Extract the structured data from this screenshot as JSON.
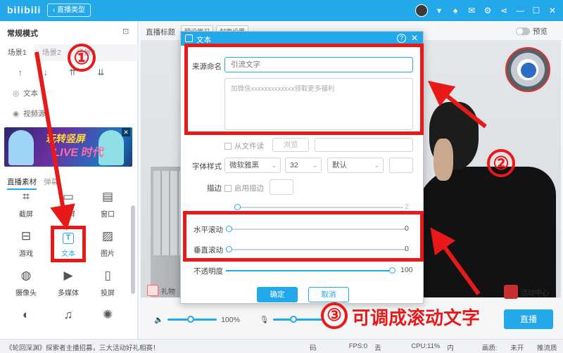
{
  "topbar": {
    "logo": "bilibili",
    "type_button": "‹ 直播类型",
    "icons": [
      "avatar",
      "shirt-icon",
      "mail-icon",
      "gear-icon",
      "share-icon",
      "minimize-icon",
      "maximize-icon",
      "close-icon"
    ]
  },
  "left": {
    "mode_label": "常规模式",
    "scenes": [
      "场景1",
      "场景2",
      "场景3"
    ],
    "sources": [
      "文本",
      "视频源"
    ],
    "banner": {
      "line1": "玩转竖屏",
      "line2": "LIVE 时代"
    },
    "material_tabs": [
      "直播素材",
      "弹幕"
    ],
    "materials": [
      "截屏",
      "全屏",
      "窗口",
      "游戏",
      "文本",
      "图片",
      "摄像头",
      "多媒体",
      "投屏"
    ]
  },
  "main": {
    "preview_title": "直播标题",
    "mini_buttons": [
      "预设学习",
      "封面设置"
    ],
    "preview_label": "预览",
    "gift_label": "礼物",
    "activity_label": "活动中心",
    "volume_value": "100%",
    "live_button": "直播"
  },
  "status": {
    "notice": "《轮回深渊》探索者主播招募，三大活动好礼相赛！",
    "stats": [
      "码率:0kbps",
      "FPS:0",
      "丢帧:0.0%",
      "CPU:11%",
      "内存:44%",
      "画质:无",
      "未开播",
      "推流质量"
    ]
  },
  "dialog": {
    "title": "文本",
    "source_name_label": "来源命名",
    "source_name_value": "引流文字",
    "text_value": "加微信xxxxxxxxxxxxx领取更多福利",
    "from_file_label": "从文件读",
    "browse_label": "浏览",
    "font_style_label": "字体样式",
    "font_family": "微软雅黑",
    "font_size": "32",
    "font_weight": "默认",
    "stroke_label": "描边",
    "enable_stroke_label": "启用描边",
    "stroke_value": "2",
    "h_scroll_label": "水平滚动",
    "h_scroll_value": "0",
    "v_scroll_label": "垂直滚动",
    "v_scroll_value": "0",
    "opacity_label": "不透明度",
    "opacity_value": "100",
    "ok_label": "确定",
    "cancel_label": "取消"
  },
  "annotations": {
    "step1": "①",
    "step2": "②",
    "step3": "③",
    "step3_text": "可调成滚动文字"
  },
  "colors": {
    "accent": "#23a8ea",
    "annotation": "#e81919"
  }
}
